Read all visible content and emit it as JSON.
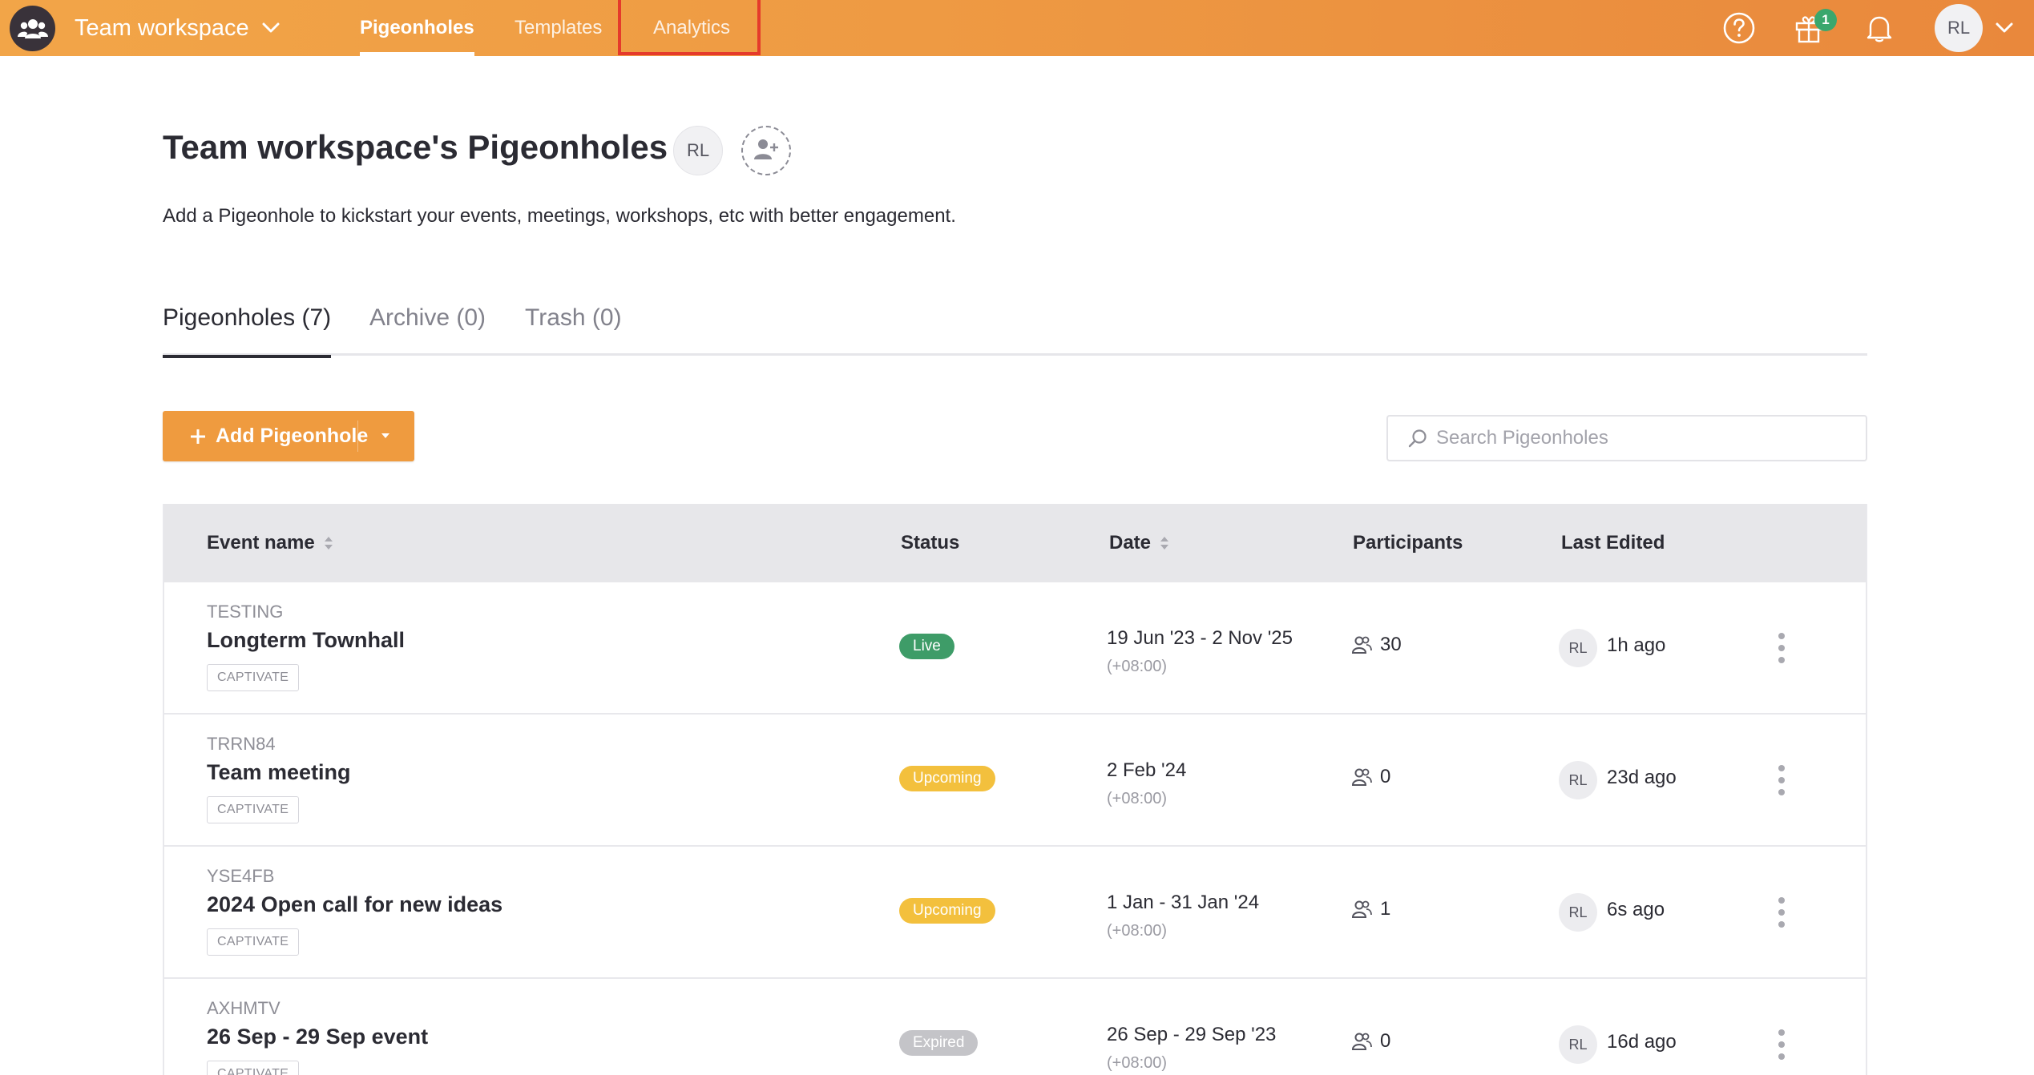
{
  "topbar": {
    "workspace_name": "Team workspace",
    "tabs": [
      {
        "label": "Pigeonholes",
        "active": true
      },
      {
        "label": "Templates",
        "active": false
      },
      {
        "label": "Analytics",
        "active": false,
        "highlighted": true
      }
    ],
    "gift_badge_count": "1",
    "user_initials": "RL",
    "icons": [
      "workspace-people-icon",
      "help-icon",
      "gift-icon",
      "bell-icon",
      "chevron-down-icon"
    ]
  },
  "page": {
    "title": "Team workspace's Pigeonholes",
    "owner_initials": "RL",
    "subtitle": "Add a Pigeonhole to kickstart your events, meetings, workshops, etc with better engagement."
  },
  "section_tabs": [
    {
      "label": "Pigeonholes (7)",
      "active": true
    },
    {
      "label": "Archive (0)",
      "active": false
    },
    {
      "label": "Trash (0)",
      "active": false
    }
  ],
  "toolbar": {
    "add_button_label": "Add Pigeonhole",
    "search_placeholder": "Search Pigeonholes"
  },
  "table": {
    "columns": [
      "Event name",
      "Status",
      "Date",
      "Participants",
      "Last Edited"
    ],
    "rows": [
      {
        "code": "TESTING",
        "name": "Longterm Townhall",
        "type": "CAPTIVATE",
        "status": "Live",
        "status_kind": "live",
        "date": "19 Jun '23 - 2 Nov '25",
        "tz": "(+08:00)",
        "participants": "30",
        "editor": "RL",
        "last_edited": "1h ago"
      },
      {
        "code": "TRRN84",
        "name": "Team meeting",
        "type": "CAPTIVATE",
        "status": "Upcoming",
        "status_kind": "upcoming",
        "date": "2 Feb '24",
        "tz": "(+08:00)",
        "participants": "0",
        "editor": "RL",
        "last_edited": "23d ago"
      },
      {
        "code": "YSE4FB",
        "name": "2024 Open call for new ideas",
        "type": "CAPTIVATE",
        "status": "Upcoming",
        "status_kind": "upcoming",
        "date": "1 Jan - 31 Jan '24",
        "tz": "(+08:00)",
        "participants": "1",
        "editor": "RL",
        "last_edited": "6s ago"
      },
      {
        "code": "AXHMTV",
        "name": "26 Sep - 29 Sep event",
        "type": "CAPTIVATE",
        "status": "Expired",
        "status_kind": "expired",
        "date": "26 Sep - 29 Sep '23",
        "tz": "(+08:00)",
        "participants": "0",
        "editor": "RL",
        "last_edited": "16d ago"
      }
    ]
  },
  "colors": {
    "topbar_start": "#f2a548",
    "topbar_end": "#e9883c",
    "accent_button": "#ef9b3f",
    "status_live": "#3e9c68",
    "status_upcoming": "#f3c03d",
    "status_expired": "#c4c4c8",
    "highlight_box": "#e53a2b"
  }
}
